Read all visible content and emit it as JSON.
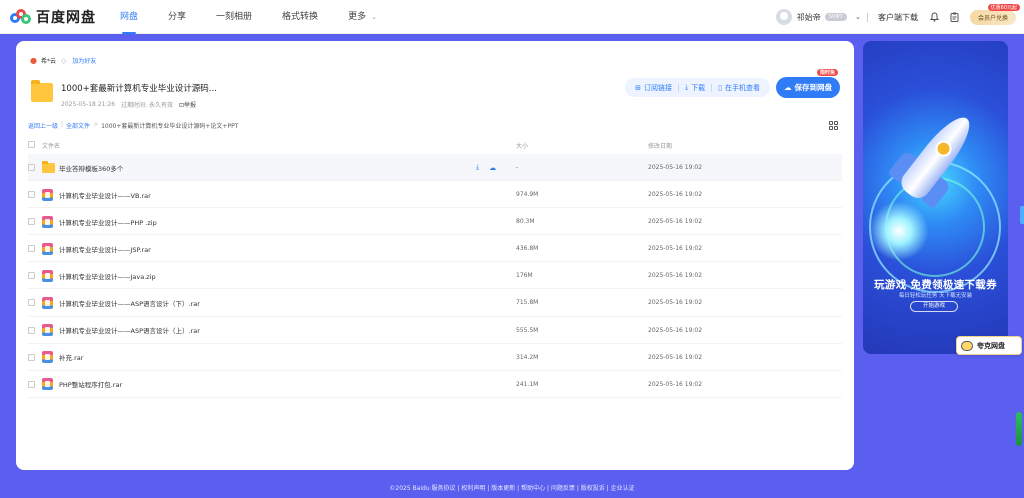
{
  "topbar": {
    "logo_text": "百度网盘",
    "nav": [
      {
        "label": "网盘",
        "active": true
      },
      {
        "label": "分享",
        "active": false
      },
      {
        "label": "一刻相册",
        "active": false
      },
      {
        "label": "格式转换",
        "active": false
      },
      {
        "label": "更多",
        "active": false
      }
    ],
    "username": "祁始帝",
    "user_badge": "SVIP7",
    "client_download": "客户端下载",
    "member_button": "会员户兑换",
    "member_tag": "优惠60元起"
  },
  "share": {
    "sharer": "希*云",
    "add_friend": "加为好友",
    "title": "1000+套最新计算机专业毕业设计源码...",
    "datetime": "2025-05-18 21:26",
    "expire_label": "过期时间: 永久有效",
    "report": "举报"
  },
  "actions": {
    "subscribe": "订阅链接",
    "download": "下载",
    "view_phone": "在手机查看",
    "save": "保存到网盘",
    "save_tag": "限时免"
  },
  "breadcrumb": {
    "back": "返回上一级",
    "all_files": "全部文件",
    "current": "1000+套最新计算机专业毕业设计源码+论文+PPT"
  },
  "table": {
    "headers": {
      "name": "文件名",
      "size": "大小",
      "modified": "修改日期"
    },
    "rows": [
      {
        "name": "毕业答辩模板360多个",
        "size": "-",
        "date": "2025-05-16 19:02",
        "type": "folder"
      },
      {
        "name": "计算机专业毕业设计——VB.rar",
        "size": "974.9M",
        "date": "2025-05-16 19:02",
        "type": "rar"
      },
      {
        "name": "计算机专业毕业设计——PHP .zip",
        "size": "80.3M",
        "date": "2025-05-16 19:02",
        "type": "rar"
      },
      {
        "name": "计算机专业毕业设计——JSP.rar",
        "size": "436.8M",
        "date": "2025-05-16 19:02",
        "type": "rar"
      },
      {
        "name": "计算机专业毕业设计——Java.zip",
        "size": "176M",
        "date": "2025-05-16 19:02",
        "type": "rar"
      },
      {
        "name": "计算机专业毕业设计——ASP语言设计（下）.rar",
        "size": "715.8M",
        "date": "2025-05-16 19:02",
        "type": "rar"
      },
      {
        "name": "计算机专业毕业设计——ASP语言设计（上）.rar",
        "size": "555.5M",
        "date": "2025-05-16 19:02",
        "type": "rar"
      },
      {
        "name": "补充.rar",
        "size": "314.2M",
        "date": "2025-05-16 19:02",
        "type": "rar"
      },
      {
        "name": "PHP整站程序打包.rar",
        "size": "241.1M",
        "date": "2025-05-16 19:02",
        "type": "rar"
      }
    ]
  },
  "ad": {
    "title": "玩游戏 免费领极速下载券",
    "subtitle": "每日轻松玩任务 天下载无安装",
    "button": "开始游戏"
  },
  "quark": {
    "label": "夸克网盘"
  },
  "footer": "©2025 Baidu  服务协议 | 权利声明 | 版本更新 | 帮助中心 | 问题反馈 | 版权投诉 | 企业认证"
}
